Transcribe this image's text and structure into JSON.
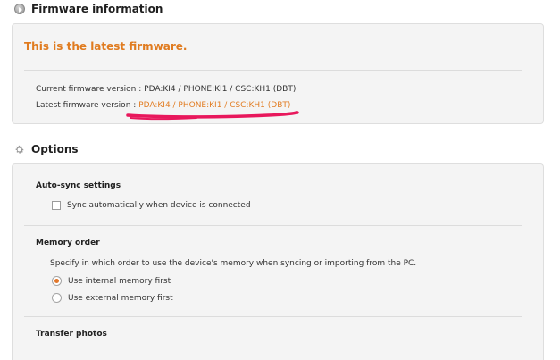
{
  "firmware": {
    "title": "Firmware information",
    "status": "This is the latest firmware.",
    "current_label": "Current firmware version : ",
    "current_value": "PDA:KI4 / PHONE:KI1 / CSC:KH1 (DBT)",
    "latest_label": "Latest firmware version : ",
    "latest_value": "PDA:KI4 / PHONE:KI1 / CSC:KH1 (DBT)"
  },
  "options": {
    "title": "Options",
    "autosync": {
      "heading": "Auto-sync settings",
      "checkbox_label": "Sync automatically when device is connected",
      "checked": false
    },
    "memory": {
      "heading": "Memory order",
      "description": "Specify in which order to use the device's memory when syncing or importing from the PC.",
      "choices": [
        "Use internal memory first",
        "Use external memory first"
      ],
      "selected_index": 0
    },
    "transfer": {
      "heading": "Transfer photos"
    }
  },
  "colors": {
    "accent": "#e07b1f",
    "annotation": "#e8185c"
  },
  "icons": {
    "firmware_section": "arrow-circle-icon",
    "options_section": "gear-icon"
  }
}
